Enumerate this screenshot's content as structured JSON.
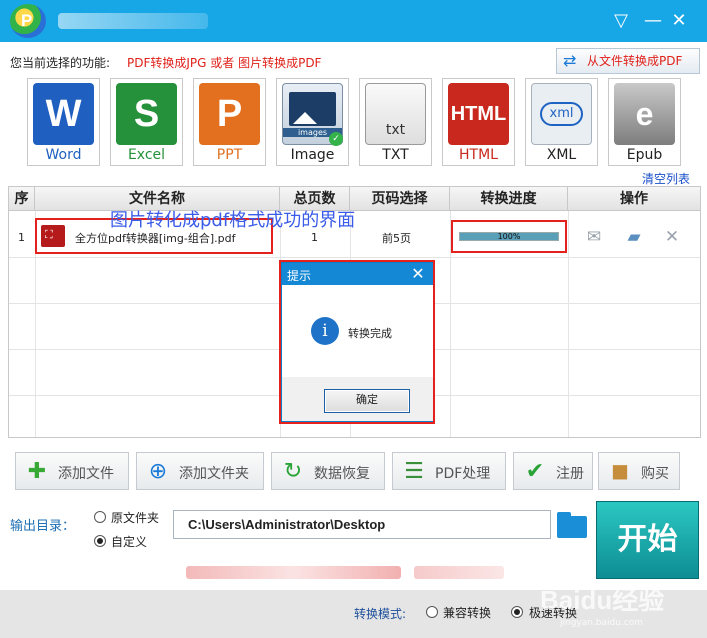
{
  "window": {
    "logo_letter": "P",
    "title_dropdown_icon": "▽",
    "minimize_icon": "—",
    "close_icon": "✕"
  },
  "function_row": {
    "label": "您当前选择的功能:",
    "value": "PDF转换成JPG 或者 图片转换成PDF",
    "from_file_button": "从文件转换成PDF"
  },
  "formats": [
    {
      "label": "Word",
      "letter": "W",
      "color": "#1f5fbf"
    },
    {
      "label": "Excel",
      "letter": "S",
      "color": "#26913b"
    },
    {
      "label": "PPT",
      "letter": "P",
      "color": "#e2701f"
    },
    {
      "label": "Image",
      "letter": "images",
      "color": "#2e5f8f"
    },
    {
      "label": "TXT",
      "letter": "txt",
      "color": "#e9e9e9"
    },
    {
      "label": "HTML",
      "letter": "HTML",
      "color": "#c8281d"
    },
    {
      "label": "XML",
      "letter": "xml",
      "color": "#e9eef2"
    },
    {
      "label": "Epub",
      "letter": "e",
      "color": "#9a9a9a"
    }
  ],
  "clear_list": "清空列表",
  "table": {
    "headers": [
      "序",
      "文件名称",
      "总页数",
      "页码选择",
      "转换进度",
      "操作"
    ],
    "rows": [
      {
        "index": "1",
        "filename": "全方位pdf转换器[img-组合].pdf",
        "pages": "1",
        "range": "前5页",
        "progress_text": "100%",
        "progress": 100
      }
    ]
  },
  "annotation": "图片转化成pdf格式成功的界面",
  "dialog": {
    "title": "提示",
    "close": "✕",
    "info_glyph": "i",
    "message": "转换完成",
    "ok": "确定"
  },
  "actions": [
    {
      "label": "添加文件",
      "icon": "add-file-icon",
      "glyph": "✚",
      "color": "#39a935"
    },
    {
      "label": "添加文件夹",
      "icon": "add-folder-icon",
      "glyph": "⊕",
      "color": "#1a7ad8"
    },
    {
      "label": "数据恢复",
      "icon": "recover-icon",
      "glyph": "↻",
      "color": "#2aa336"
    },
    {
      "label": "PDF处理",
      "icon": "pdf-process-icon",
      "glyph": "☰",
      "color": "#3a8f3a"
    },
    {
      "label": "注册",
      "icon": "check-icon",
      "glyph": "✔",
      "color": "#2aa336"
    },
    {
      "label": "购买",
      "icon": "bag-icon",
      "glyph": "◼",
      "color": "#c58d3c"
    }
  ],
  "output": {
    "label": "输出目录：",
    "option_original": "原文件夹",
    "option_custom": "自定义",
    "path": "C:\\Users\\Administrator\\Desktop",
    "start": "开始"
  },
  "mode": {
    "label": "转换模式:",
    "option_compat": "兼容转换",
    "option_fast": "极速转换"
  },
  "watermark": {
    "text": "Baidu经验",
    "sub": "jingyan.baidu.com"
  }
}
